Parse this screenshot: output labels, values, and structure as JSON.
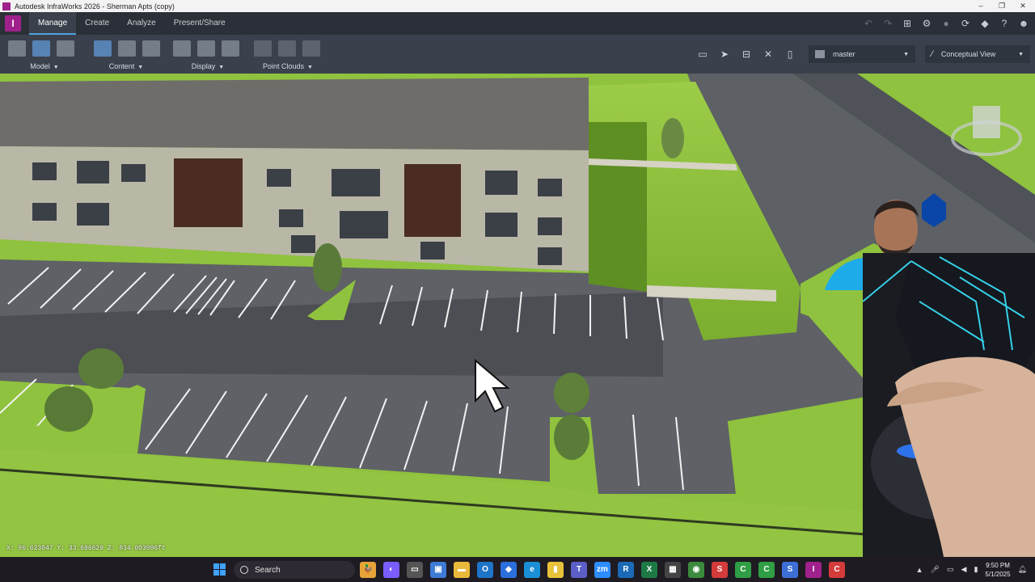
{
  "window": {
    "title": "Autodesk InfraWorks 2026 - Sherman Apts (copy)",
    "minimize": "–",
    "maximize": "❐",
    "close": "✕"
  },
  "brand": {
    "letter": "I",
    "color": "#a0218c"
  },
  "tabs": [
    {
      "label": "Manage",
      "active": true
    },
    {
      "label": "Create",
      "active": false
    },
    {
      "label": "Analyze",
      "active": false
    },
    {
      "label": "Present/Share",
      "active": false
    }
  ],
  "ribbon": {
    "groups": [
      {
        "label": "Model",
        "icons": [
          "model-grid-icon",
          "model-window-icon",
          "model-edit-icon"
        ]
      },
      {
        "label": "Content",
        "icons": [
          "database-icon",
          "data-table-icon",
          "globe-icon"
        ]
      },
      {
        "label": "Display",
        "icons": [
          "layers-icon",
          "terrain-icon",
          "list-icon"
        ]
      },
      {
        "label": "Point Clouds",
        "icons": [
          "point-cloud-icon",
          "point-cloud-terrain-icon",
          "point-cloud-edit-icon"
        ]
      }
    ],
    "proposal_combo": {
      "value": "master"
    },
    "view_combo": {
      "value": "Conceptual View"
    }
  },
  "viewport": {
    "coordinates": "X: 96.623047 Y: 33.686629 Z: 834.003096ft"
  },
  "taskbar": {
    "search_label": "Search",
    "apps": [
      {
        "name": "widgets-app",
        "glyph": "🦆",
        "color": "#e6a338"
      },
      {
        "name": "copilot-app",
        "glyph": "◐",
        "color": "#7a5cff"
      },
      {
        "name": "task-view-app",
        "glyph": "▭",
        "color": "#555"
      },
      {
        "name": "store-app",
        "glyph": "▣",
        "color": "#3d7bd6"
      },
      {
        "name": "file-explorer-app",
        "glyph": "▬",
        "color": "#e8b93a"
      },
      {
        "name": "outlook-app",
        "glyph": "O",
        "color": "#1d74c9"
      },
      {
        "name": "dropbox-app",
        "glyph": "◆",
        "color": "#2b6fdc"
      },
      {
        "name": "edge-app",
        "glyph": "e",
        "color": "#1a8fd6"
      },
      {
        "name": "notes-app",
        "glyph": "▮",
        "color": "#e8c23a"
      },
      {
        "name": "teams-app",
        "glyph": "T",
        "color": "#5b5fc7"
      },
      {
        "name": "zoom-app",
        "glyph": "zm",
        "color": "#2d8cff"
      },
      {
        "name": "revit-app",
        "glyph": "R",
        "color": "#1b6ab8"
      },
      {
        "name": "excel-app",
        "glyph": "X",
        "color": "#1d7a45"
      },
      {
        "name": "calculator-app",
        "glyph": "▦",
        "color": "#444"
      },
      {
        "name": "chrome-app",
        "glyph": "◉",
        "color": "#3c8a3e"
      },
      {
        "name": "s-app",
        "glyph": "S",
        "color": "#d43b3b"
      },
      {
        "name": "civil3d-app",
        "glyph": "C",
        "color": "#2f9e44"
      },
      {
        "name": "civil3d-green-app",
        "glyph": "C",
        "color": "#2f9e44"
      },
      {
        "name": "s2-app",
        "glyph": "S",
        "color": "#3d6fd6"
      },
      {
        "name": "infraworks-app",
        "glyph": "I",
        "color": "#a0218c"
      },
      {
        "name": "autocad-app",
        "glyph": "C",
        "color": "#d43b3b"
      }
    ],
    "time": "9:50 PM",
    "date": "5/1/2025"
  }
}
